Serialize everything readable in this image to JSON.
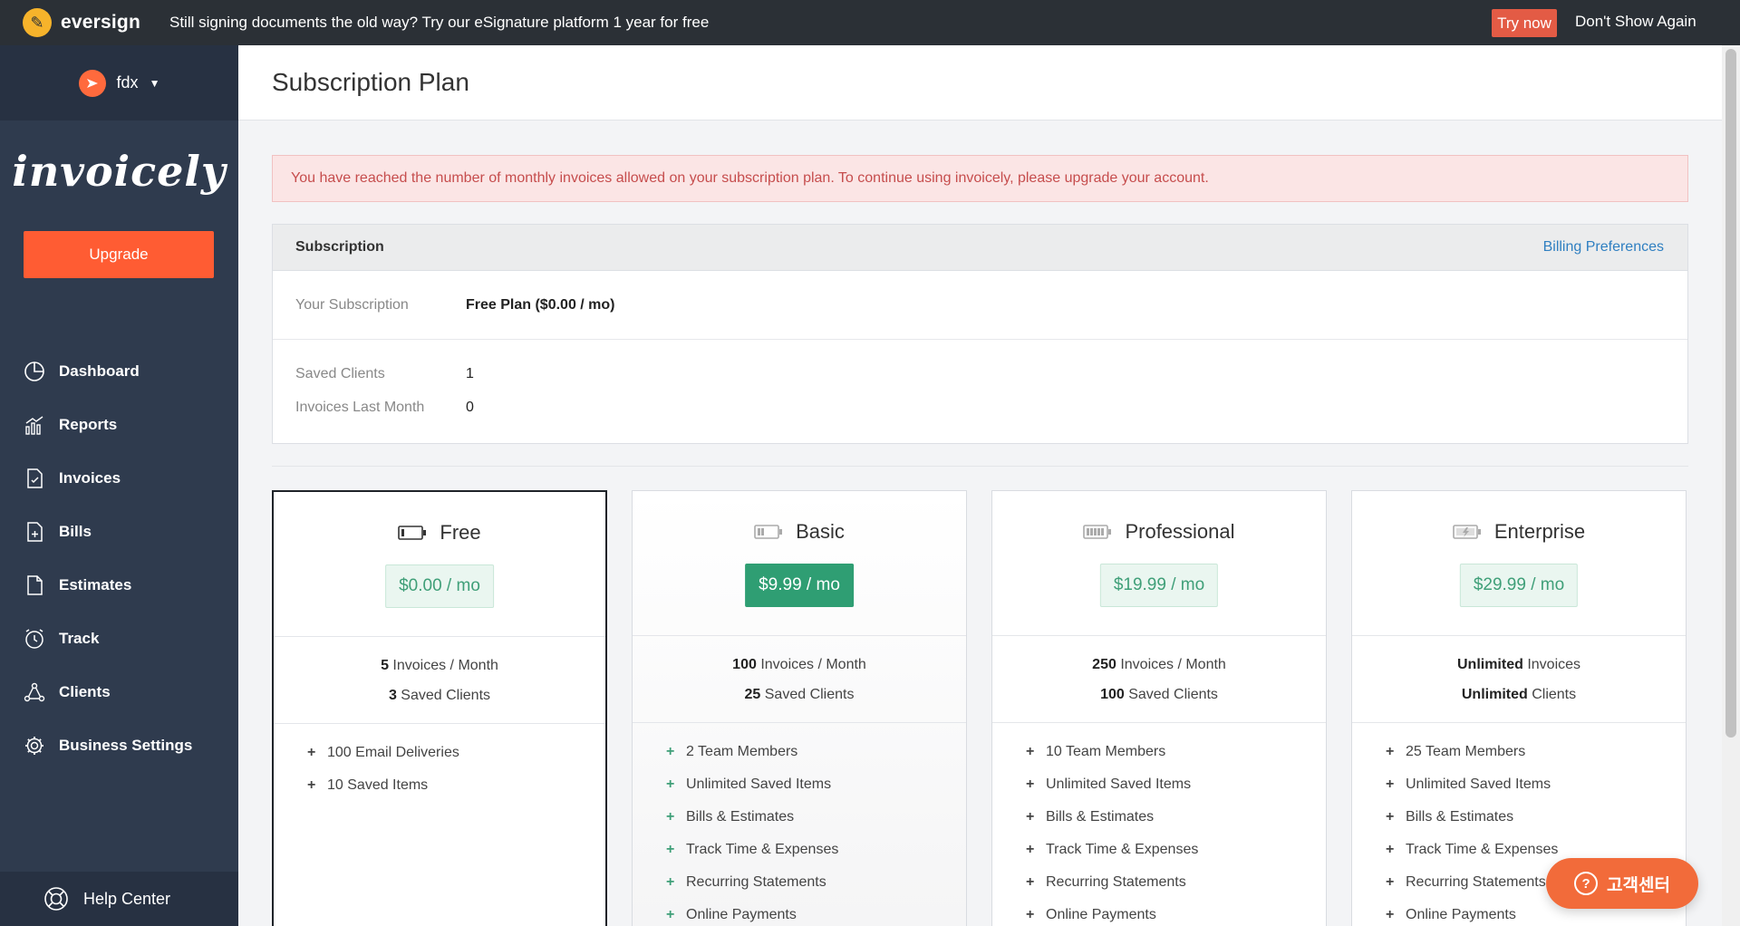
{
  "banner": {
    "brand": "eversign",
    "promo": "Still signing documents the old way? Try our eSignature platform 1 year for free",
    "try_label": "Try now",
    "dismiss_label": "Don't Show Again"
  },
  "sidebar": {
    "account_name": "fdx",
    "app_logo": "invoicely",
    "upgrade_label": "Upgrade",
    "items": [
      {
        "label": "Dashboard",
        "icon": "dashboard-icon"
      },
      {
        "label": "Reports",
        "icon": "reports-icon"
      },
      {
        "label": "Invoices",
        "icon": "invoices-icon"
      },
      {
        "label": "Bills",
        "icon": "bills-icon"
      },
      {
        "label": "Estimates",
        "icon": "estimates-icon"
      },
      {
        "label": "Track",
        "icon": "track-icon"
      },
      {
        "label": "Clients",
        "icon": "clients-icon"
      },
      {
        "label": "Business Settings",
        "icon": "settings-icon"
      }
    ],
    "help_label": "Help Center"
  },
  "page": {
    "title": "Subscription Plan",
    "alert": "You have reached the number of monthly invoices allowed on your subscription plan. To continue using invoicely, please upgrade your account."
  },
  "subscription": {
    "heading": "Subscription",
    "link": "Billing Preferences",
    "your_subscription_label": "Your Subscription",
    "your_subscription_value": "Free Plan ($0.00 / mo)",
    "saved_clients_label": "Saved Clients",
    "saved_clients_value": "1",
    "invoices_last_month_label": "Invoices Last Month",
    "invoices_last_month_value": "0"
  },
  "plans": [
    {
      "name": "Free",
      "price": "$0.00 / mo",
      "invoices_num": "5",
      "invoices_text": " Invoices / Month",
      "clients_num": "3",
      "clients_text": " Saved Clients",
      "features": [
        "100 Email Deliveries",
        "10 Saved Items"
      ]
    },
    {
      "name": "Basic",
      "price": "$9.99 / mo",
      "invoices_num": "100",
      "invoices_text": " Invoices / Month",
      "clients_num": "25",
      "clients_text": " Saved Clients",
      "features": [
        "2 Team Members",
        "Unlimited Saved Items",
        "Bills & Estimates",
        "Track Time & Expenses",
        "Recurring Statements",
        "Online Payments"
      ]
    },
    {
      "name": "Professional",
      "price": "$19.99 / mo",
      "invoices_num": "250",
      "invoices_text": " Invoices / Month",
      "clients_num": "100",
      "clients_text": " Saved Clients",
      "features": [
        "10 Team Members",
        "Unlimited Saved Items",
        "Bills & Estimates",
        "Track Time & Expenses",
        "Recurring Statements",
        "Online Payments"
      ]
    },
    {
      "name": "Enterprise",
      "price": "$29.99 / mo",
      "invoices_num": "Unlimited",
      "invoices_text": " Invoices",
      "clients_num": "Unlimited",
      "clients_text": " Clients",
      "features": [
        "25 Team Members",
        "Unlimited Saved Items",
        "Bills & Estimates",
        "Track Time & Expenses",
        "Recurring Statements",
        "Online Payments"
      ]
    }
  ],
  "float_help": {
    "label": "고객센터"
  },
  "colors": {
    "accent": "#ff5c33",
    "sidebar": "#2f3b4e",
    "price_green": "#2f9e73",
    "alert_bg": "#fbe5e5",
    "alert_text": "#c64d4d"
  }
}
